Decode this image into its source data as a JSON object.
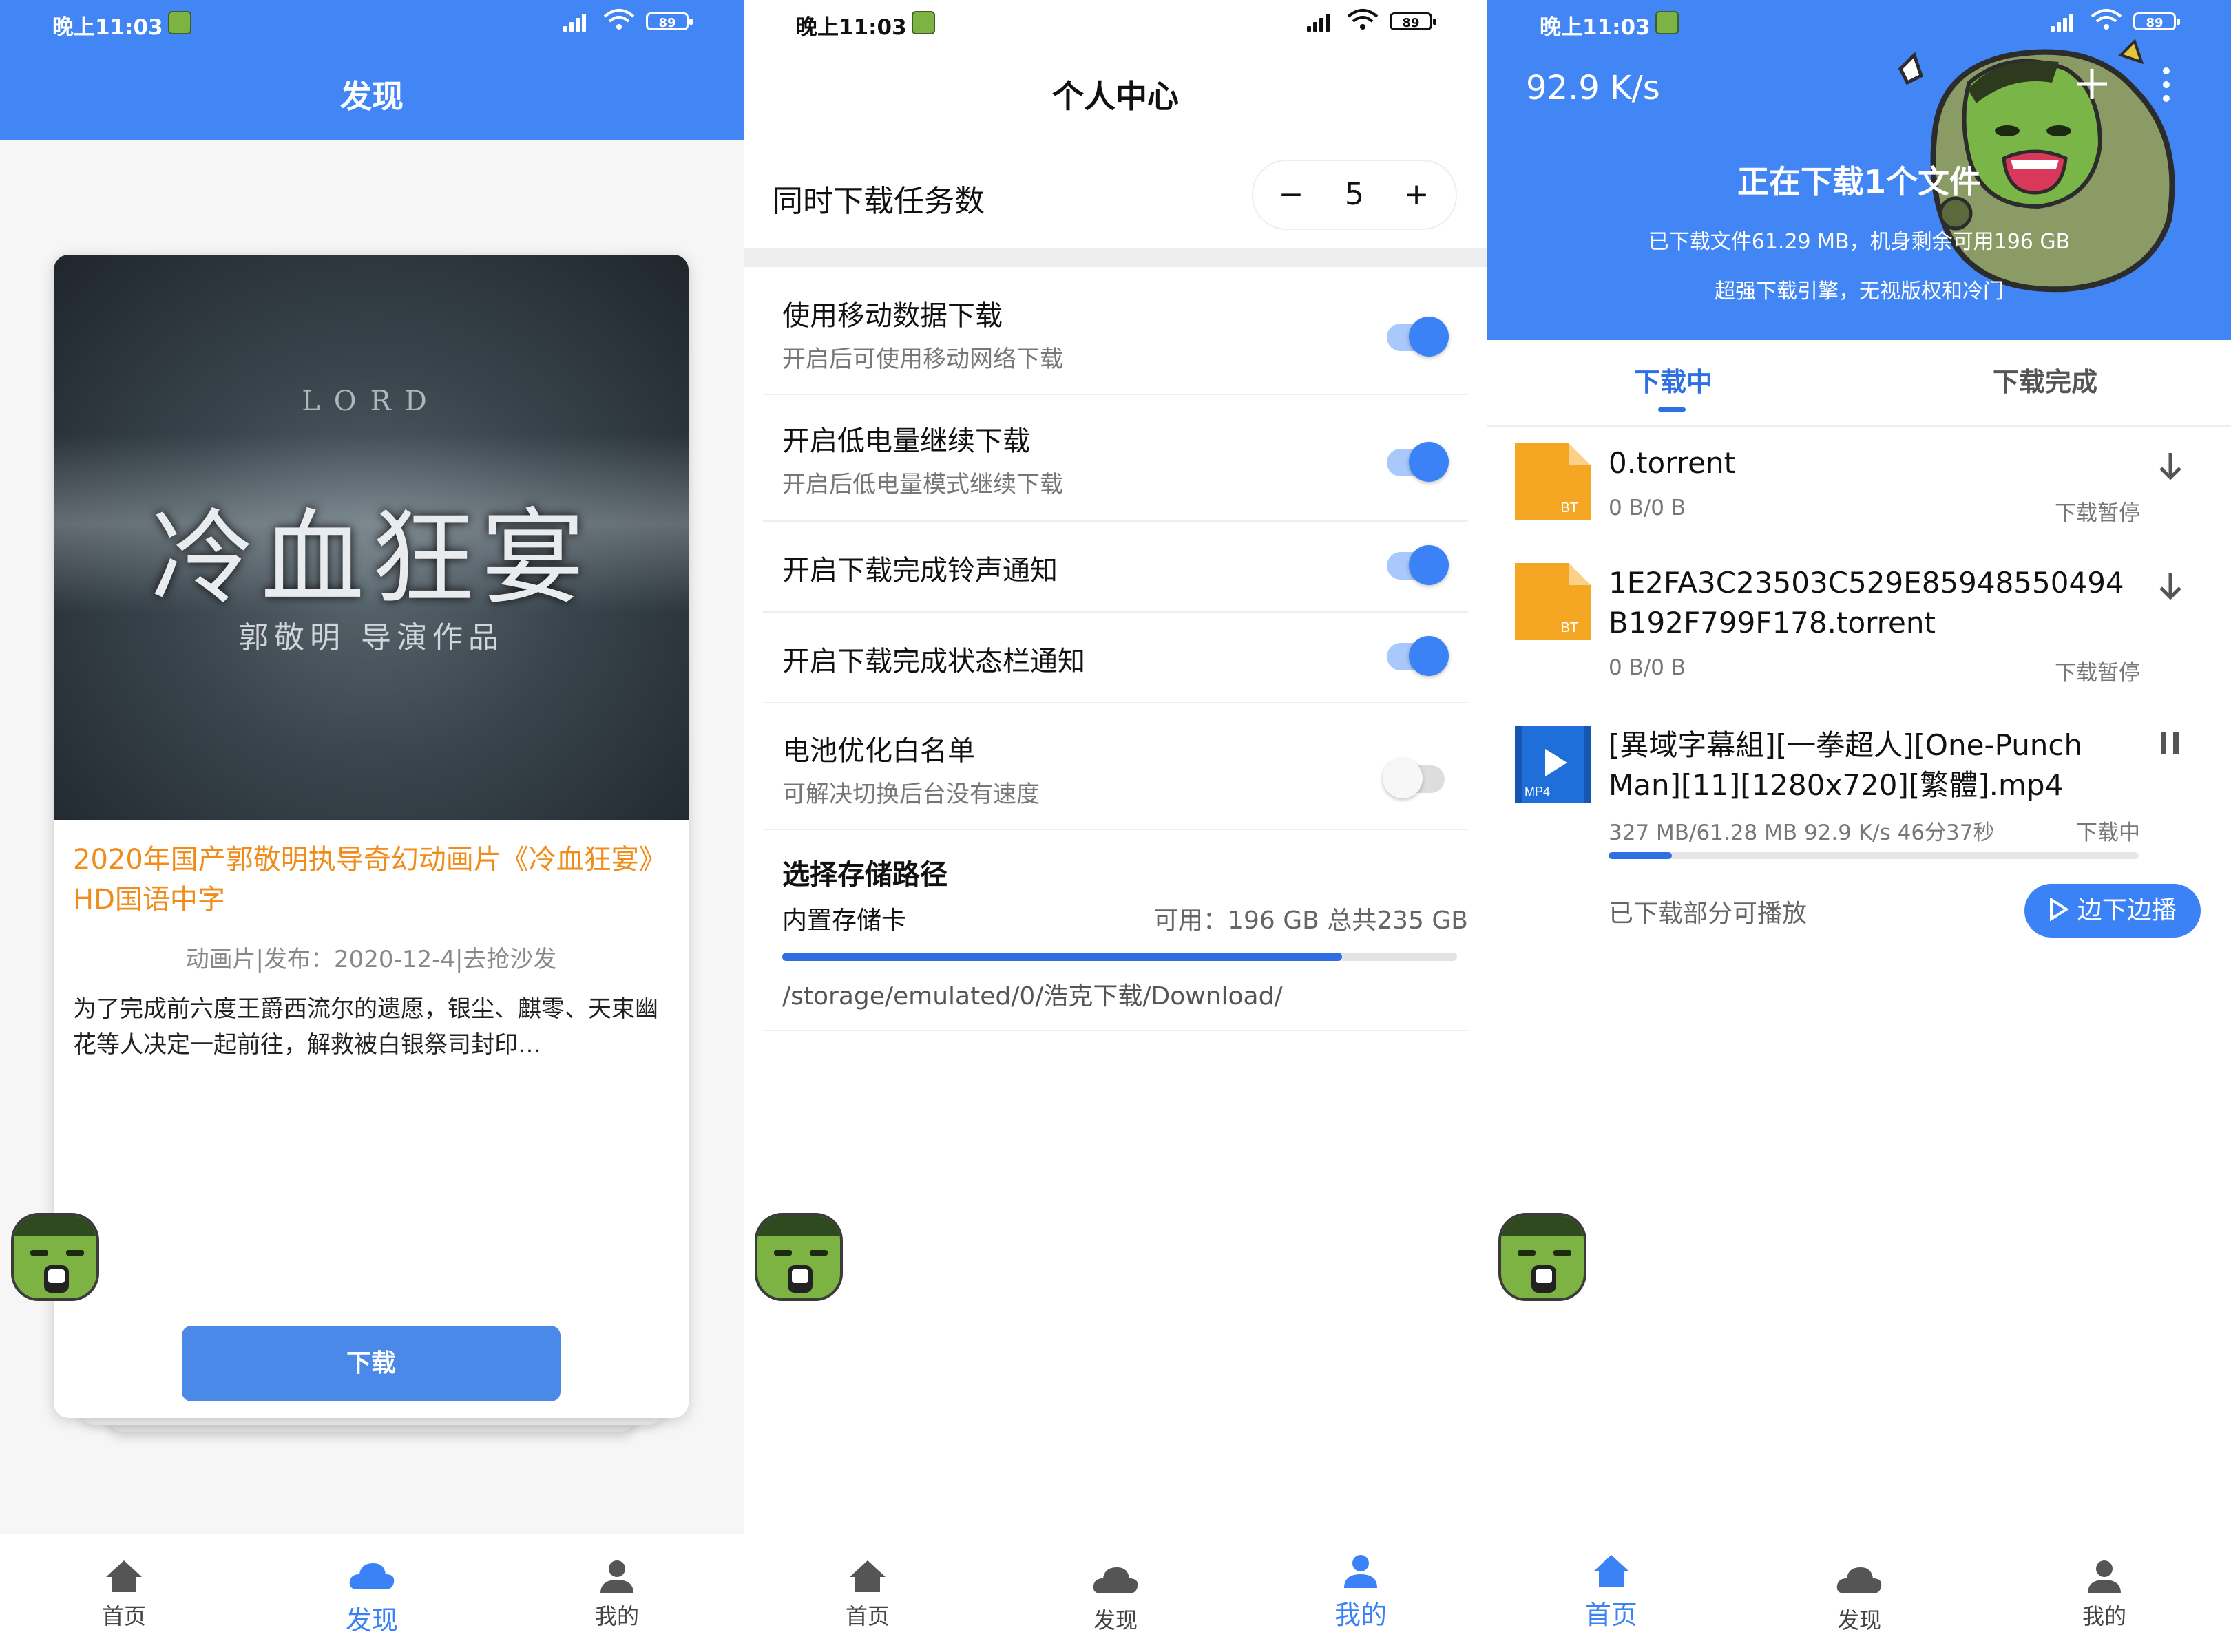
{
  "status_time": "晚上11:03",
  "battery": "89",
  "nav": {
    "home": "首页",
    "discover": "发现",
    "mine": "我的"
  },
  "discover": {
    "title": "发现",
    "poster_title": "冷血狂宴",
    "poster_subtitle": "郭敬明 导演作品",
    "poster_top": "LORD",
    "movie_title": "2020年国产郭敬明执导奇幻动画片《冷血狂宴》HD国语中字",
    "meta": "动画片|发布：2020-12-4|去抢沙发",
    "description": "为了完成前六度王爵西流尔的遗愿，银尘、麒零、天束幽花等人决定一起前往，解救被白银祭司封印…",
    "download_button": "下载"
  },
  "profile": {
    "title": "个人中心",
    "concurrent_label": "同时下载任务数",
    "concurrent_value": "5",
    "minus": "−",
    "plus": "+",
    "settings": [
      {
        "label": "使用移动数据下载",
        "sub": "开启后可使用移动网络下载",
        "on": true
      },
      {
        "label": "开启低电量继续下载",
        "sub": "开启后低电量模式继续下载",
        "on": true
      },
      {
        "label": "开启下载完成铃声通知",
        "on": true
      },
      {
        "label": "开启下载完成状态栏通知",
        "on": true
      },
      {
        "label": "电池优化白名单",
        "sub": "可解决切换后台没有速度",
        "on": false
      }
    ],
    "storage_title": "选择存储路径",
    "storage_name": "内置存储卡",
    "storage_info": "可用：196 GB 总共235 GB",
    "storage_used_fraction": 0.83,
    "storage_path": "/storage/emulated/0/浩克下载/Download/"
  },
  "downloads": {
    "speed": "92.9 K/s",
    "heading": "正在下载1个文件",
    "info1": "已下载文件61.29 MB，机身剩余可用196 GB",
    "info2": "超强下载引擎，无视版权和冷门",
    "tab_active": "下载中",
    "tab_done": "下载完成",
    "files": [
      {
        "name": "0.torrent",
        "size": "0 B/0 B",
        "status": "下载暂停",
        "badge": "BT"
      },
      {
        "name": "1E2FA3C23503C529E85948550494B192F799F178.torrent",
        "size": "0 B/0 B",
        "status": "下载暂停",
        "badge": "BT"
      },
      {
        "name": "[異域字幕組][一拳超人][One-Punch Man][11][1280x720][繁體].mp4",
        "size": "327 MB/61.28 MB  92.9 K/s  46分37秒",
        "status": "下载中",
        "badge": "MP4",
        "progress": 0.12
      }
    ],
    "playable": "已下载部分可播放",
    "play_button": "边下边播"
  },
  "colors": {
    "primary": "#4285f4",
    "orange_title": "#f08c1a",
    "bt_icon": "#f5a623",
    "mp4_icon": "#1e6fd9"
  }
}
